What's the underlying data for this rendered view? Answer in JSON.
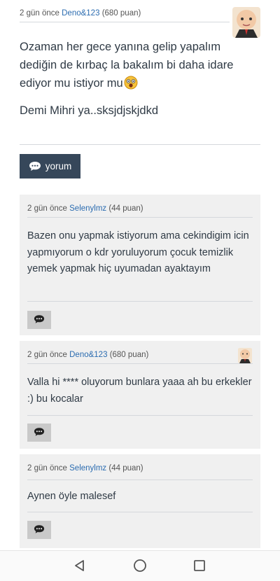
{
  "post": {
    "time": "2 gün önce",
    "user": "Deno&123",
    "points": "(680 puan)",
    "body_lines": [
      "Ozaman her gece yanına gelip yapalım dediğin de kırbaç la bakalım bi daha idare ediyor mu istiyor mu",
      "Demi Mihri ya..sksjdjskjdkd"
    ],
    "emoji_icon": "astonished-face-icon"
  },
  "yorum_button": {
    "label": "yorum",
    "icon": "speech-bubble-icon"
  },
  "comments": [
    {
      "time": "2 gün önce",
      "user": "Selenylmz",
      "points": "(44 puan)",
      "text": "Bazen onu yapmak istiyorum ama cekindigim icin yapmıyorum  o kdr yoruluyorum çocuk temizlik yemek yapmak hiç uyumadan ayaktayım",
      "has_avatar": false
    },
    {
      "time": "2 gün önce",
      "user": "Deno&123",
      "points": "(680 puan)",
      "text": "Valla hi **** oluyorum bunlara  yaaa ah bu erkekler :) bu kocalar",
      "has_avatar": true
    },
    {
      "time": "2 gün önce",
      "user": "Selenylmz",
      "points": "(44 puan)",
      "text": "Aynen öyle malesef",
      "has_avatar": false
    }
  ],
  "navbar": {
    "icons": [
      "back-triangle-icon",
      "home-circle-icon",
      "recents-square-icon"
    ]
  },
  "colors": {
    "button_dark": "#36475a",
    "link": "#2b6cb0",
    "card_bg": "#f0f0f0",
    "reply_btn": "#c9c9c9"
  }
}
